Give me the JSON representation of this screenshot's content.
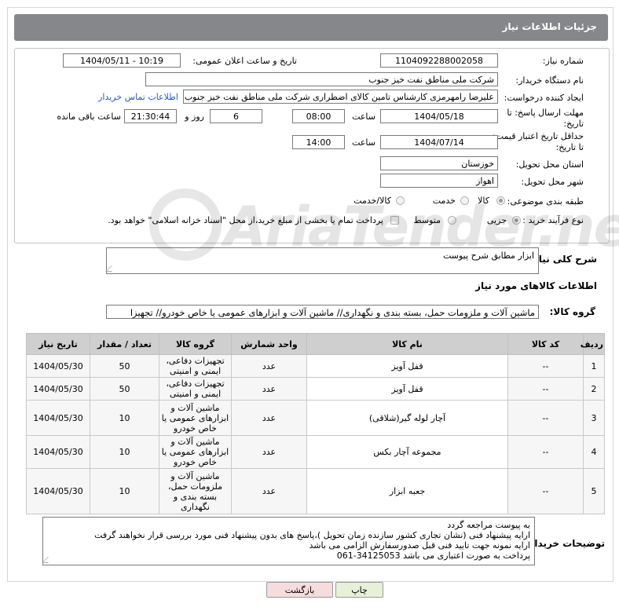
{
  "header": {
    "title": "جزئیات اطلاعات نیاز"
  },
  "form": {
    "need_number_label": "شماره نیاز:",
    "need_number": "1104092288002058",
    "announce_label": "تاریخ و ساعت اعلان عمومی:",
    "announce_value": "1404/05/11 - 10:19",
    "buyer_org_label": "نام دستگاه خریدار:",
    "buyer_org": "شرکت ملی مناطق نفت خیز جنوب",
    "creator_label": "ایجاد کننده درخواست:",
    "creator": "علیرضا رامهرمزی کارشناس تامین کالای اضطراری شرکت ملی مناطق نفت خیز جنوب",
    "contact_link": "اطلاعات تماس خریدار",
    "deadline_label_1": "مهلت ارسال پاسخ: تا",
    "deadline_label_2": "تاریخ:",
    "deadline_date": "1404/05/18",
    "time_label": "ساعت",
    "deadline_time": "08:00",
    "days_value": "6",
    "days_label": "روز و",
    "remaining_time": "21:30:44",
    "remaining_label": "ساعت باقی مانده",
    "price_validity_label_1": "حداقل تاریخ اعتبار قیمت:",
    "price_validity_label_2": "تا تاریخ:",
    "validity_date": "1404/07/14",
    "validity_time": "14:00",
    "province_label": "استان محل تحویل:",
    "province": "خوزستان",
    "city_label": "شهر محل تحویل:",
    "city": "اهواز",
    "category_label": "طبقه بندی موضوعی:",
    "category_options": [
      "کالا",
      "خدمت",
      "کالا/خدمت"
    ],
    "process_label": "نوع فرآیند خرید :",
    "process_options": [
      "جزیی",
      "متوسط"
    ],
    "payment_note": "پرداخت تمام یا بخشی از مبلغ خرید،از محل \"اسناد خزانه اسلامی\" خواهد بود."
  },
  "description": {
    "label": "شرح کلی نیاز:",
    "value": "ابزار مطابق شرح پیوست"
  },
  "goods": {
    "section_title": "اطلاعات کالاهای مورد نیاز",
    "group_label": "گروه کالا:",
    "group_value": "ماشین آلات و ملزومات حمل، بسته بندی و نگهداری//  ماشین آلات و ابزارهای عمومی یا خاص خودرو// تجهیزا"
  },
  "table": {
    "headers": [
      "ردیف",
      "کد کالا",
      "نام کالا",
      "واحد شمارش",
      "گروه کالا",
      "تعداد / مقدار",
      "تاریخ نیاز"
    ],
    "rows": [
      {
        "row": "1",
        "code": "--",
        "name": "قفل آویز",
        "unit": "عدد",
        "group": "تجهیزات دفاعی، ایمنی و امنیتی",
        "qty": "50",
        "date": "1404/05/30"
      },
      {
        "row": "2",
        "code": "--",
        "name": "قفل آویز",
        "unit": "عدد",
        "group": "تجهیزات دفاعی، ایمنی و امنیتی",
        "qty": "50",
        "date": "1404/05/30"
      },
      {
        "row": "3",
        "code": "--",
        "name": "آچار لوله گیر(شلاقی)",
        "unit": "عدد",
        "group": "ماشین آلات و ابزارهای عمومی یا خاص خودرو",
        "qty": "10",
        "date": "1404/05/30"
      },
      {
        "row": "4",
        "code": "--",
        "name": "مجموعه آچار بکس",
        "unit": "عدد",
        "group": "ماشین آلات و ابزارهای عمومی یا خاص خودرو",
        "qty": "10",
        "date": "1404/05/30"
      },
      {
        "row": "5",
        "code": "--",
        "name": "جعبه ابزار",
        "unit": "عدد",
        "group": "ماشین آلات و ملزومات حمل، بسته بندی و نگهداری",
        "qty": "10",
        "date": "1404/05/30"
      }
    ]
  },
  "buyer_notes": {
    "label": "توضیحات خریدار:",
    "lines": [
      "به پیوست مراجعه گردد",
      "ارایه پیشنهاد فنی (نشان تجاری کشور سازنده زمان تحویل )،پاسخ های بدون پیشنهاد فنی مورد بررسی قرار نخواهند گرفت",
      "ارایه نمونه جهت تایید فنی قبل صدورسفارش الزامی می باشد",
      "پرداخت به صورت اعتباری می باشد 34125053-061"
    ]
  },
  "buttons": {
    "print": "چاپ",
    "back": "بازگشت"
  },
  "watermark": "AriaTender.neT"
}
